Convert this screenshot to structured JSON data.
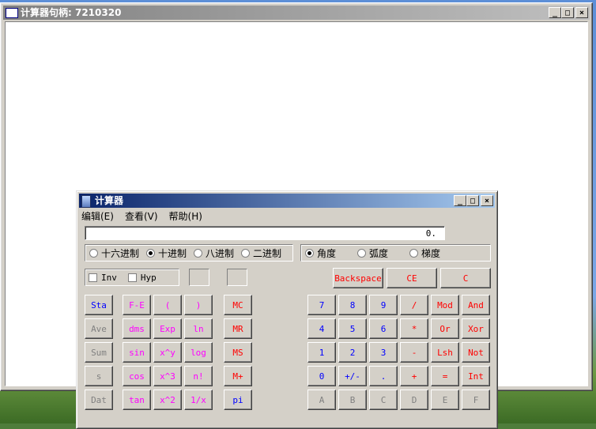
{
  "outer_window": {
    "title": "计算器句柄: 7210320",
    "min_glyph": "_",
    "max_glyph": "□",
    "close_glyph": "×"
  },
  "calculator": {
    "title": "计算器",
    "menu": [
      "编辑(E)",
      "查看(V)",
      "帮助(H)"
    ],
    "display_value": "0.",
    "bases": [
      {
        "label": "十六进制",
        "selected": false
      },
      {
        "label": "十进制",
        "selected": true
      },
      {
        "label": "八进制",
        "selected": false
      },
      {
        "label": "二进制",
        "selected": false
      }
    ],
    "angles": [
      {
        "label": "角度",
        "selected": true
      },
      {
        "label": "弧度",
        "selected": false
      },
      {
        "label": "梯度",
        "selected": false
      }
    ],
    "checks": [
      {
        "label": "Inv",
        "checked": false
      },
      {
        "label": "Hyp",
        "checked": false
      }
    ],
    "top_buttons": [
      "Backspace",
      "CE",
      "C"
    ],
    "stat_buttons": [
      "Sta",
      "Ave",
      "Sum",
      "s",
      "Dat"
    ],
    "func_col1": [
      "F-E",
      "dms",
      "sin",
      "cos",
      "tan"
    ],
    "func_col2": [
      "(",
      "Exp",
      "x^y",
      "x^3",
      "x^2"
    ],
    "func_col3": [
      ")",
      "ln",
      "log",
      "n!",
      "1/x"
    ],
    "mem_buttons": [
      "MC",
      "MR",
      "MS",
      "M+",
      "pi"
    ],
    "keypad": [
      [
        "7",
        "8",
        "9",
        "/",
        "Mod",
        "And"
      ],
      [
        "4",
        "5",
        "6",
        "*",
        "Or",
        "Xor"
      ],
      [
        "1",
        "2",
        "3",
        "-",
        "Lsh",
        "Not"
      ],
      [
        "0",
        "+/-",
        ".",
        "+",
        "=",
        "Int"
      ],
      [
        "A",
        "B",
        "C",
        "D",
        "E",
        "F"
      ]
    ],
    "colors": {
      "digit": "#0000ff",
      "operator": "#ff0000",
      "function": "#ff00ff",
      "disabled": "#808080"
    }
  }
}
